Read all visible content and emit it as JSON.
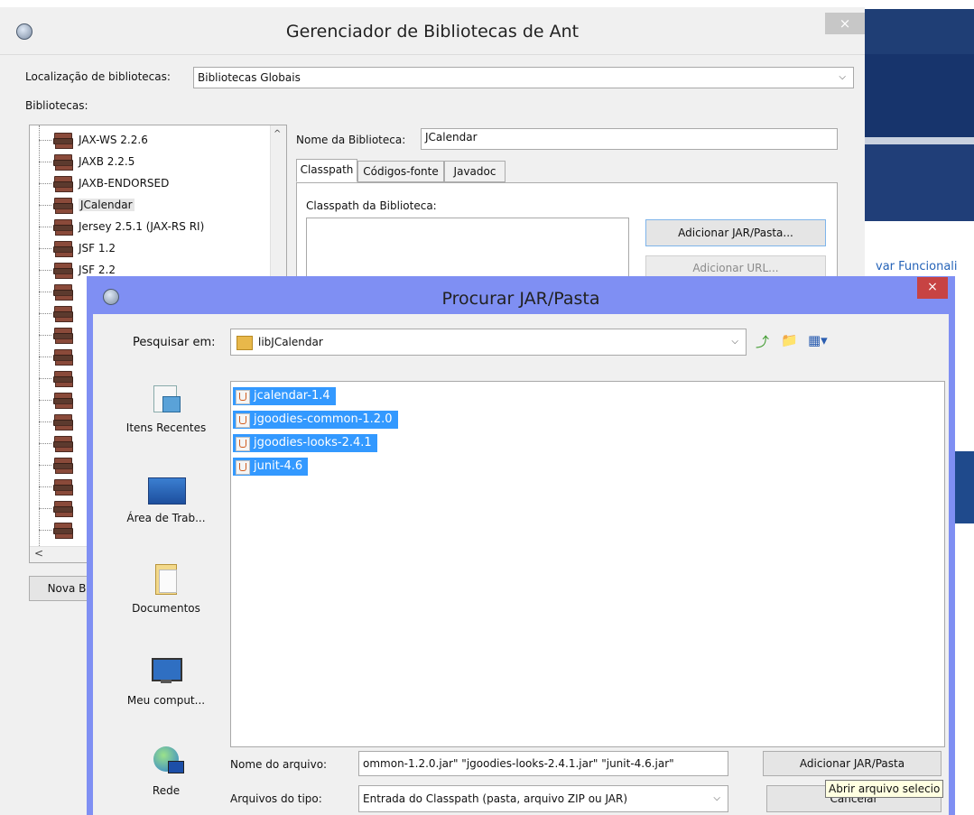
{
  "library_manager": {
    "title": "Gerenciador de Bibliotecas de Ant",
    "close_label": "×",
    "location_label": "Localização de bibliotecas:",
    "location_value": "Bibliotecas Globais",
    "libraries_label": "Bibliotecas:",
    "libraries": [
      "JAX-WS 2.2.6",
      "JAXB 2.2.5",
      "JAXB-ENDORSED",
      "JCalendar",
      "Jersey 2.5.1 (JAX-RS RI)",
      "JSF 1.2",
      "JSF 2.2"
    ],
    "selected_library": "JCalendar",
    "new_library_button": "Nova B",
    "library_name_label": "Nome da Biblioteca:",
    "library_name_value": "JCalendar",
    "tabs": [
      "Classpath",
      "Códigos-fonte",
      "Javadoc"
    ],
    "active_tab": "Classpath",
    "classpath_label": "Classpath da Biblioteca:",
    "add_jar_button": "Adicionar JAR/Pasta...",
    "add_url_button": "Adicionar URL..."
  },
  "background_app": {
    "link_text": "var Funcionali"
  },
  "chooser": {
    "title": "Procurar JAR/Pasta",
    "close_label": "×",
    "look_in_label": "Pesquisar em:",
    "look_in_value": "libJCalendar",
    "places": [
      "Itens Recentes",
      "Área de Trab...",
      "Documentos",
      "Meu comput...",
      "Rede"
    ],
    "files": [
      "jcalendar-1.4",
      "jgoodies-common-1.2.0",
      "jgoodies-looks-2.4.1",
      "junit-4.6"
    ],
    "filename_label": "Nome do arquivo:",
    "filename_value": "ommon-1.2.0.jar\" \"jgoodies-looks-2.4.1.jar\" \"junit-4.6.jar\"",
    "filetype_label": "Arquivos do tipo:",
    "filetype_value": "Entrada do Classpath (pasta, arquivo ZIP ou JAR)",
    "approve_button": "Adicionar JAR/Pasta",
    "cancel_button": "Cancelar",
    "tooltip": "Abrir arquivo selecio"
  },
  "colors": {
    "chooser_frame": "#7f8ff3",
    "selection": "#3399ff",
    "close_red": "#c74343"
  }
}
